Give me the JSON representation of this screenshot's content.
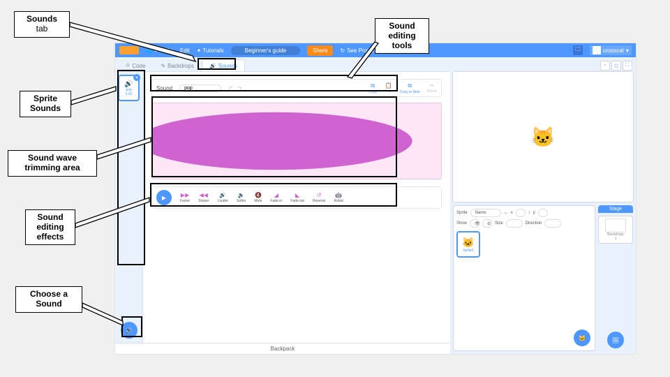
{
  "callouts": {
    "sounds_tab": {
      "l1": "Sounds",
      "l2": "tab"
    },
    "sprite_sounds": "Sprite\nSounds",
    "trim": "Sound wave\ntrimming area",
    "effects": "Sound\nediting\neffects",
    "choose": "Choose a\nSound",
    "tools": "Sound\nediting\ntools"
  },
  "topbar": {
    "globe": "🌐",
    "file": "File",
    "edit": "Edit",
    "tutorials": "Tutorials",
    "guide": "Beginner's guide",
    "share": "Share",
    "see_project": "See Project Page",
    "username": "crosscat"
  },
  "tabs": {
    "code": "Code",
    "backdrops": "Backdrops",
    "sounds": "Sounds"
  },
  "sound_list": {
    "selected": {
      "name": "pop",
      "duration": "0.02"
    }
  },
  "editor": {
    "sound_label": "Sound",
    "sound_name": "pop",
    "tools": {
      "copy": "Copy",
      "paste": "Paste",
      "copy_new": "Copy to New",
      "delete": "Delete"
    },
    "effects": [
      "Faster",
      "Slower",
      "Louder",
      "Softer",
      "Mute",
      "Fade in",
      "Fade out",
      "Reverse",
      "Robot"
    ]
  },
  "sprite_panel": {
    "sprite_lbl": "Sprite",
    "name_lbl": "Name",
    "x_lbl": "x",
    "y_lbl": "y",
    "show_lbl": "Show",
    "size_lbl": "Size",
    "dir_lbl": "Direction",
    "sprite_name": "Sprite1"
  },
  "stage_side": {
    "stage": "Stage",
    "backdrops_lbl": "Backdrops",
    "backdrops_n": "1"
  },
  "backpack": "Backpack"
}
